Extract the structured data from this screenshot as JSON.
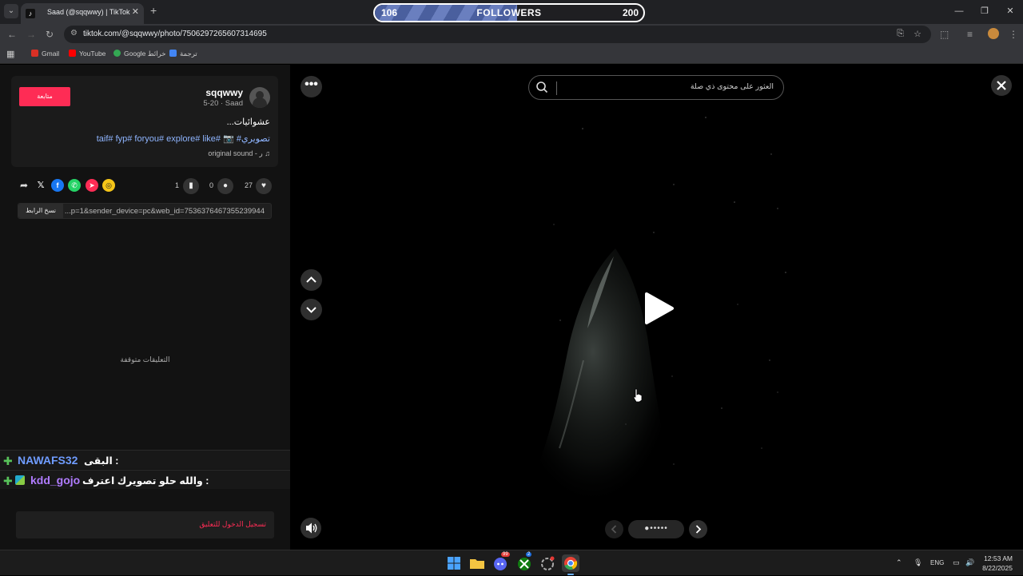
{
  "browser": {
    "tab_title": "Saad (@sqqwwy) | TikTok",
    "tab_close": "✕",
    "new_tab": "+",
    "url": "tiktok.com/@sqqwwy/photo/7506297265607314695",
    "bookmarks": [
      {
        "label": "Gmail",
        "color": "#d93025"
      },
      {
        "label": "YouTube",
        "color": "#ff0000"
      },
      {
        "label": "Google خرائط",
        "color": "#34a853"
      },
      {
        "label": "ترجمة",
        "color": "#4285f4"
      }
    ]
  },
  "followers_goal": {
    "current": "106",
    "label": "FOLLOWERS",
    "goal": "200",
    "progress_fraction": 0.53
  },
  "profile": {
    "follow_label": "متابعة",
    "username": "sqqwwy",
    "subline": "5-20 · Saad",
    "caption": "عشوائيات...",
    "tags": "taif# fyp# foryou# explore# like# 📷 #تصويري",
    "sound": "original sound - ر"
  },
  "stats": {
    "likes": "27",
    "comments": "0",
    "saves": "1"
  },
  "share": {
    "copy_label": "نسخ الرابط",
    "link": "...p=1&sender_device=pc&web_id=7536376467355239944"
  },
  "comments_off": "التعليقات متوقفة",
  "chat": [
    {
      "user": "NAWAFS32",
      "message": "البقى :",
      "user_color": "#6f9cff"
    },
    {
      "user": "kdd_gojo",
      "message": "والله حلو تصويرك اعترف :",
      "user_color": "#b07cff"
    }
  ],
  "login_prompt": "تسجيل الدخول للتعليق",
  "viewer": {
    "search_placeholder": "العثور على محتوى ذي صلة",
    "carousel_dots": "●•••••"
  },
  "taskbar": {
    "lang": "ENG",
    "time": "12:53 AM",
    "date": "8/22/2025",
    "discord_badge": "99",
    "xbox_badge": "2"
  }
}
